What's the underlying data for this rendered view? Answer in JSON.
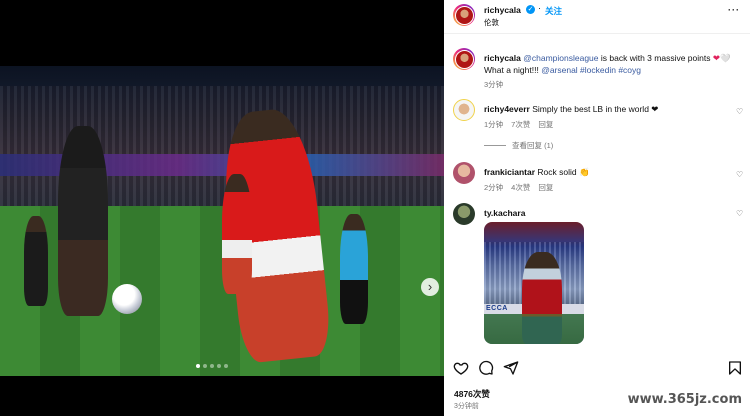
{
  "header": {
    "username": "richycala",
    "verified": true,
    "follow_label": "关注",
    "location": "伦敦",
    "more": "···"
  },
  "caption": {
    "username": "richycala",
    "mention": "@championsleague",
    "text_1": "is back with 3 massive points",
    "emoji": "❤🤍",
    "text_2": "What a night!!!",
    "tags": "@arsenal #lockedin #coyg",
    "time": "3分钟"
  },
  "comments": [
    {
      "username": "richy4everr",
      "text": "Simply the best LB in the world ❤",
      "time": "1分钟",
      "likes": "7次赞",
      "reply": "回复",
      "view_replies": "查看回复 (1)"
    },
    {
      "username": "frankiciantar",
      "text": "Rock solid 👏",
      "time": "2分钟",
      "likes": "4次赞",
      "reply": "回复"
    },
    {
      "username": "ty.kachara",
      "embed_ad": "ECCA"
    }
  ],
  "likes_count": "4876次赞",
  "posted_ago": "3分钟前",
  "carousel": {
    "total": 5,
    "active": 0
  },
  "watermark": "www.365jz.com",
  "colors": {
    "accent_blue": "#0095f6",
    "heart_red": "#ed4956",
    "arsenal_red": "#db0007"
  }
}
